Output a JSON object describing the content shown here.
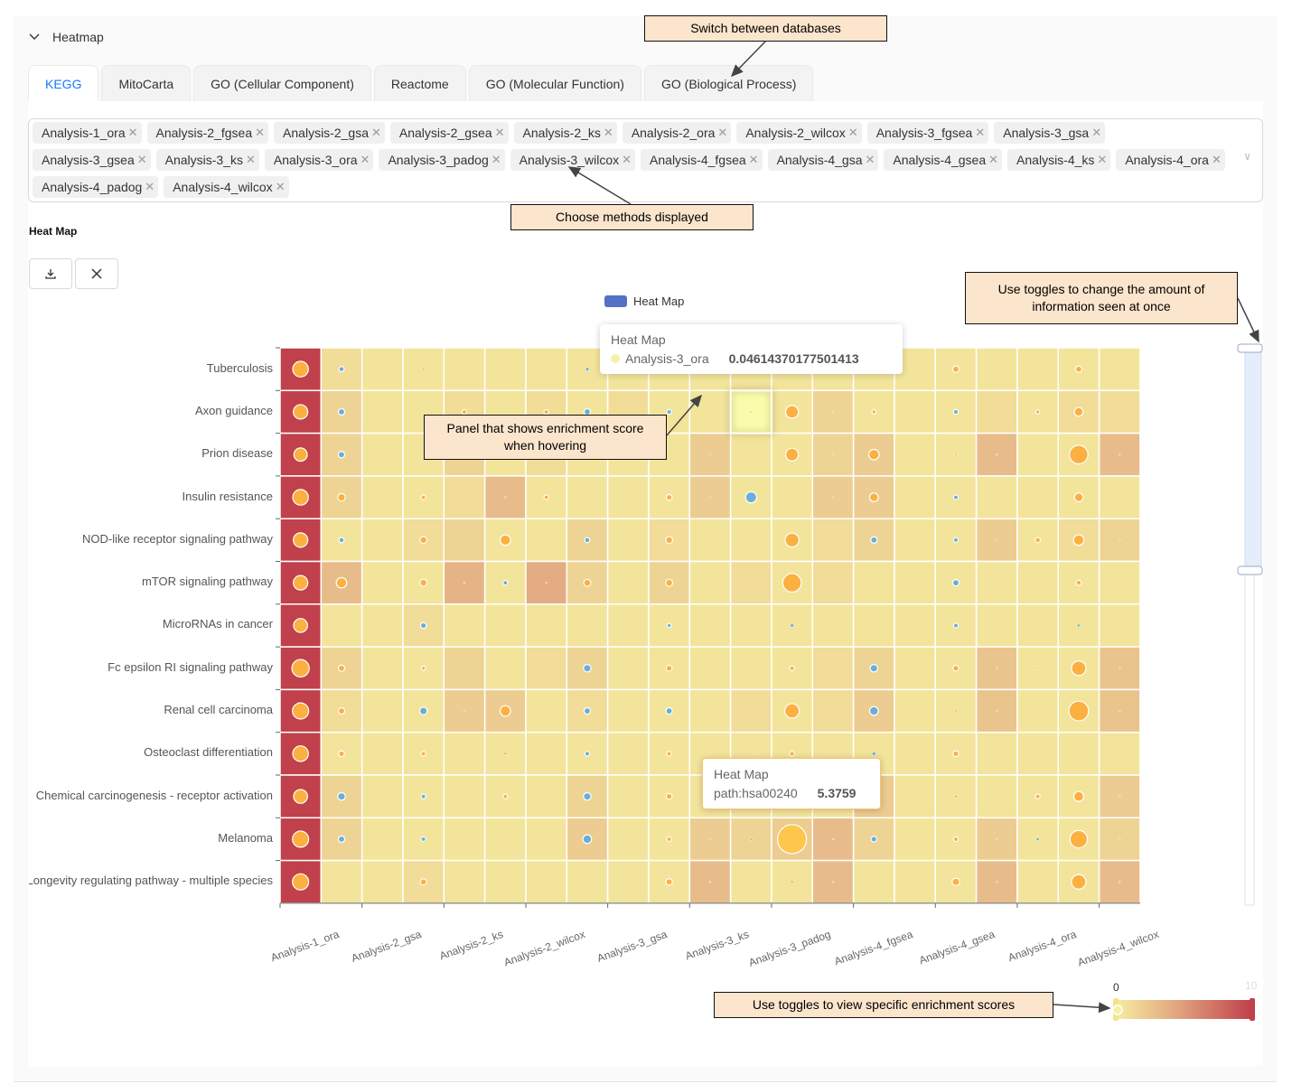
{
  "section": {
    "title": "Heatmap",
    "collapse_icon": "chevron-down-icon"
  },
  "tabs": [
    {
      "label": "KEGG",
      "active": true
    },
    {
      "label": "MitoCarta"
    },
    {
      "label": "GO (Cellular Component)"
    },
    {
      "label": "Reactome"
    },
    {
      "label": "GO (Molecular Function)"
    },
    {
      "label": "GO (Biological Process)"
    }
  ],
  "methods_selected": [
    "Analysis-1_ora",
    "Analysis-2_fgsea",
    "Analysis-2_gsa",
    "Analysis-2_gsea",
    "Analysis-2_ks",
    "Analysis-2_ora",
    "Analysis-2_wilcox",
    "Analysis-3_fgsea",
    "Analysis-3_gsa",
    "Analysis-3_gsea",
    "Analysis-3_ks",
    "Analysis-3_ora",
    "Analysis-3_padog",
    "Analysis-3_wilcox",
    "Analysis-4_fgsea",
    "Analysis-4_gsa",
    "Analysis-4_gsea",
    "Analysis-4_ks",
    "Analysis-4_ora",
    "Analysis-4_padog",
    "Analysis-4_wilcox"
  ],
  "chart_title": "Heat Map",
  "toolbar": {
    "download_icon": "download-icon",
    "close_icon": "close-icon"
  },
  "colors": {
    "low": "#f5ec9f",
    "mid": "#e1a47f",
    "high": "#c0404b",
    "dot_positive": "#fcb040",
    "dot_negative": "#6aaed6",
    "legend": "#5470c6"
  },
  "chart_data": {
    "type": "heatmap",
    "legend": {
      "label": "Heat Map",
      "position": "top"
    },
    "x_categories": [
      "Analysis-1_ora",
      "Analysis-2_fgsea",
      "Analysis-2_gsa",
      "Analysis-2_gsea",
      "Analysis-2_ks",
      "Analysis-2_ora",
      "Analysis-2_wilcox",
      "Analysis-3_fgsea",
      "Analysis-3_gsa",
      "Analysis-3_gsea",
      "Analysis-3_ks",
      "Analysis-3_ora",
      "Analysis-3_padog",
      "Analysis-3_wilcox",
      "Analysis-4_fgsea",
      "Analysis-4_gsa",
      "Analysis-4_gsea",
      "Analysis-4_ks",
      "Analysis-4_ora",
      "Analysis-4_padog",
      "Analysis-4_wilcox"
    ],
    "x_tick_labels_shown": [
      "Analysis-1_ora",
      "Analysis-2_gsa",
      "Analysis-2_ks",
      "Analysis-2_wilcox",
      "Analysis-3_gsa",
      "Analysis-3_ks",
      "Analysis-3_padog",
      "Analysis-4_fgsea",
      "Analysis-4_gsea",
      "Analysis-4_ora",
      "Analysis-4_wilcox"
    ],
    "visual_map": {
      "min": 0,
      "max": 10,
      "selected_range": [
        0,
        10
      ],
      "min_label": "0",
      "max_label": "10"
    },
    "rows": [
      {
        "label": "Tuberculosis",
        "heat": [
          10,
          1,
          0.5,
          0.5,
          0.5,
          0.5,
          0.5,
          0.5,
          0.5,
          0.5,
          0.5,
          0.5,
          0.5,
          0.5,
          0.5,
          0.5,
          0.5,
          0.5,
          0.5,
          0.5,
          0.5
        ],
        "dots": [
          2.7,
          -0.9,
          0.2,
          0.4,
          0,
          0,
          0,
          -0.6,
          0,
          0,
          0,
          0,
          0,
          0,
          -0.4,
          0.2,
          1.1,
          0,
          0,
          1.1,
          0
        ]
      },
      {
        "label": "Axon guidance",
        "heat": [
          10,
          1.5,
          0.5,
          0.5,
          1,
          0.5,
          1,
          0.5,
          1,
          0.5,
          0.5,
          0,
          0.5,
          1.5,
          0.5,
          0.5,
          0.5,
          1,
          0.5,
          1,
          1
        ],
        "dots": [
          2.5,
          -1.1,
          0.1,
          0,
          0.8,
          0,
          0.8,
          -1.1,
          0,
          -0.8,
          0.1,
          0.1,
          2.2,
          0.1,
          0.7,
          0.3,
          -0.8,
          0.1,
          0.7,
          1.5,
          0.1
        ]
      },
      {
        "label": "Prion disease",
        "heat": [
          10,
          1.5,
          0.5,
          0.5,
          1.5,
          0.5,
          1,
          0.5,
          0.5,
          0.5,
          2,
          0.5,
          0.5,
          1.5,
          2,
          0.5,
          0.5,
          3,
          0.5,
          0.5,
          3
        ],
        "dots": [
          2.3,
          -1.1,
          0.2,
          0,
          0,
          0,
          0,
          -0.6,
          0,
          0,
          0.2,
          0.3,
          2.2,
          0.3,
          1.8,
          0.1,
          0.4,
          0.2,
          0.1,
          3.2,
          0.2
        ]
      },
      {
        "label": "Insulin resistance",
        "heat": [
          10,
          1.5,
          0.5,
          0.5,
          1,
          3,
          0.5,
          0.5,
          0.5,
          0.5,
          2,
          0.5,
          0.5,
          2,
          2,
          0.5,
          0.5,
          0.5,
          0.5,
          0.5,
          0.5
        ],
        "dots": [
          2.7,
          1.3,
          0.1,
          0.8,
          0.2,
          0.3,
          0.8,
          0.1,
          0.1,
          1,
          0.2,
          -1.9,
          0.3,
          0.2,
          1.5,
          0.2,
          -0.8,
          0,
          0,
          1.5,
          0
        ]
      },
      {
        "label": "NOD-like receptor signaling pathway",
        "heat": [
          10,
          0.5,
          0.5,
          1,
          1.5,
          0.5,
          0.5,
          1.5,
          0.5,
          1,
          0.5,
          0.5,
          0.5,
          1,
          1.5,
          0.5,
          0.5,
          2,
          0.5,
          1,
          1.5
        ],
        "dots": [
          2.5,
          -0.9,
          0,
          1.2,
          0,
          1.8,
          0,
          -0.9,
          0.2,
          1.2,
          0,
          0.1,
          2.4,
          0.1,
          -1.1,
          0.2,
          -0.8,
          0.1,
          0.9,
          1.8,
          0.1
        ]
      },
      {
        "label": "mTOR signaling pathway",
        "heat": [
          10,
          3,
          0.5,
          0.5,
          3.5,
          0.5,
          4,
          1.5,
          0.5,
          1.5,
          0.5,
          1,
          0.5,
          1,
          0.5,
          0.5,
          0.5,
          0.5,
          0.5,
          0.5,
          0.5
        ],
        "dots": [
          2.5,
          1.8,
          0,
          1.2,
          0.2,
          -0.8,
          0.2,
          1.2,
          0.1,
          1.2,
          0.1,
          0.3,
          3.2,
          0.1,
          0.2,
          0.3,
          -1.1,
          0,
          0,
          0.9,
          0
        ]
      },
      {
        "label": "MicroRNAs in cancer",
        "heat": [
          10,
          0.5,
          0.5,
          1,
          0.5,
          0.5,
          0.5,
          0.5,
          0.5,
          0.5,
          0.5,
          0.5,
          0.5,
          0.5,
          0.5,
          0.5,
          0.5,
          0.5,
          0.5,
          0.5,
          0.5
        ],
        "dots": [
          2.4,
          0,
          0.2,
          -1,
          0,
          0,
          0,
          0,
          0.1,
          -0.7,
          0,
          0,
          -0.6,
          0.1,
          0,
          0.1,
          -0.8,
          0,
          0,
          -0.5,
          0
        ]
      },
      {
        "label": "Fc epsilon RI signaling pathway",
        "heat": [
          10,
          1.5,
          0.5,
          0.5,
          1.5,
          0.5,
          1,
          1.5,
          0.5,
          0.5,
          0.5,
          0.5,
          0.5,
          1,
          1.5,
          0.5,
          0.5,
          2.5,
          0.5,
          0.5,
          2.5
        ],
        "dots": [
          3,
          1.1,
          0.2,
          0.7,
          0,
          0,
          0,
          -1.3,
          0,
          1,
          0,
          0.3,
          0.8,
          0,
          -1.3,
          0.1,
          1,
          0.2,
          0.4,
          2.5,
          0.2
        ]
      },
      {
        "label": "Renal cell carcinoma",
        "heat": [
          10,
          1,
          0.5,
          0.5,
          2,
          2,
          0.5,
          1,
          0.5,
          0.5,
          0.5,
          1,
          0.5,
          1,
          2,
          0.5,
          0.5,
          2.5,
          0.5,
          0.5,
          2.5
        ],
        "dots": [
          2.8,
          1.1,
          0.3,
          -1.3,
          0.1,
          1.8,
          0,
          -1.1,
          0,
          -1.1,
          0,
          0.3,
          2.5,
          0,
          -1.5,
          0,
          0.4,
          0.3,
          0.3,
          3.4,
          0.3
        ]
      },
      {
        "label": "Osteoclast differentiation",
        "heat": [
          10,
          0.5,
          0.5,
          0.5,
          0.5,
          0.5,
          0.5,
          0.5,
          0.5,
          0.5,
          0.5,
          0.5,
          0.5,
          0.5,
          0.5,
          0.5,
          0.5,
          0.5,
          0.5,
          0.5,
          0.5
        ],
        "dots": [
          2.7,
          1,
          0.1,
          0.8,
          0,
          0.5,
          0,
          -0.8,
          0,
          0.8,
          0,
          0.2,
          0.8,
          0.1,
          -0.6,
          0.1,
          1,
          0,
          0,
          0.1,
          0
        ]
      },
      {
        "label": "Chemical carcinogenesis - receptor activation",
        "heat": [
          10,
          1.5,
          0.5,
          0.5,
          0.5,
          0.5,
          0.5,
          1.5,
          0.5,
          0.5,
          0.5,
          0.5,
          0.5,
          0.5,
          2,
          0.5,
          0.5,
          0.5,
          0.5,
          0.5,
          2
        ],
        "dots": [
          2.4,
          -1.3,
          0.2,
          -0.8,
          0.1,
          0.8,
          0,
          -1.3,
          0,
          1,
          0,
          0,
          0,
          0,
          -1.5,
          0.3,
          0.5,
          0,
          0.8,
          1.7,
          0.2
        ]
      },
      {
        "label": "Melanoma",
        "heat": [
          10,
          1.5,
          0.5,
          0.5,
          0.5,
          0.5,
          0.5,
          2,
          0.5,
          0.5,
          2,
          1.5,
          2,
          3,
          1.5,
          0.5,
          0.5,
          2,
          0.5,
          0.5,
          1.5
        ],
        "dots": [
          2.8,
          -1.1,
          0.1,
          -0.8,
          0,
          0,
          0,
          -1.5,
          0,
          0.8,
          0.2,
          0.5,
          5,
          0.2,
          -1,
          0.1,
          0.8,
          0.2,
          -0.5,
          3,
          0.1
        ]
      },
      {
        "label": "Longevity regulating pathway - multiple species",
        "heat": [
          10,
          0.5,
          0.5,
          1,
          0.5,
          0.5,
          0.5,
          0.5,
          0.5,
          0.5,
          3,
          0.5,
          0.5,
          3,
          0.5,
          0.5,
          0.5,
          3,
          0.5,
          0.5,
          3
        ],
        "dots": [
          2.8,
          0,
          0.2,
          1.1,
          0,
          0,
          0,
          0,
          0,
          1.1,
          0.2,
          0,
          0.5,
          0.2,
          0,
          0.3,
          1.3,
          0.2,
          0,
          2.5,
          0.2
        ]
      }
    ]
  },
  "tooltips": [
    {
      "title": "Heat Map",
      "series": "Analysis-3_ora",
      "value": "0.04614370177501413"
    },
    {
      "title": "Heat Map",
      "series": "path:hsa00240",
      "value": "5.3759"
    }
  ],
  "annotations": {
    "switch_db": "Switch between databases",
    "choose_methods": "Choose methods displayed",
    "hover_panel": "Panel that shows enrichment score when hovering",
    "toggles_amount": "Use toggles to change the amount of information seen at once",
    "toggles_scores": "Use toggles to view specific enrichment scores"
  }
}
